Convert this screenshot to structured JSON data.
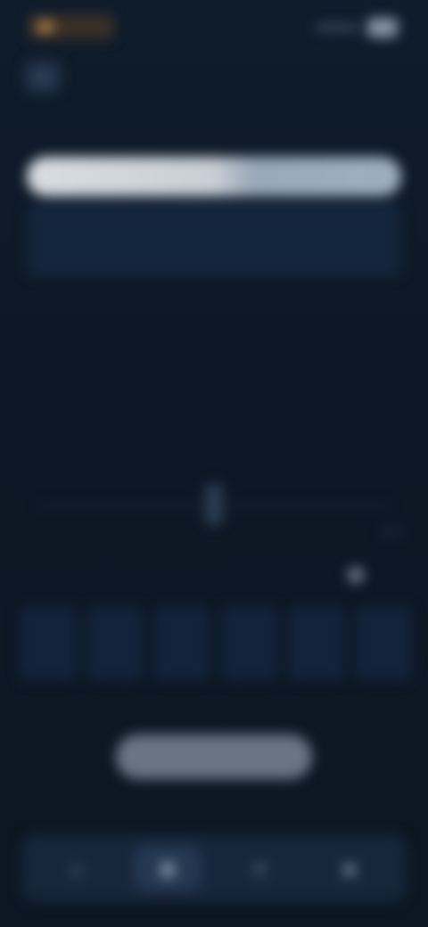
{
  "header": {
    "title": "",
    "back_label": "‹"
  },
  "search": {
    "section_label": "",
    "placeholder": "",
    "value": "",
    "icon": "search-icon"
  },
  "info_card": {
    "text": ""
  },
  "content": {
    "title": "",
    "subtitle": ""
  },
  "row": {
    "label": "",
    "toggle_label": ""
  },
  "tiles": [
    "",
    "",
    "",
    "",
    "",
    ""
  ],
  "primary_button": {
    "label": ""
  },
  "bottom_nav": {
    "items": [
      {
        "icon": "home-icon",
        "glyph": "⌂"
      },
      {
        "icon": "grid-icon",
        "glyph": "▦"
      },
      {
        "icon": "bell-icon",
        "glyph": "◔"
      },
      {
        "icon": "user-icon",
        "glyph": "●"
      }
    ],
    "active_index": 1
  },
  "colors": {
    "background": "#0e1a28",
    "accent": "#c6ced8",
    "button": "#6a7584"
  }
}
